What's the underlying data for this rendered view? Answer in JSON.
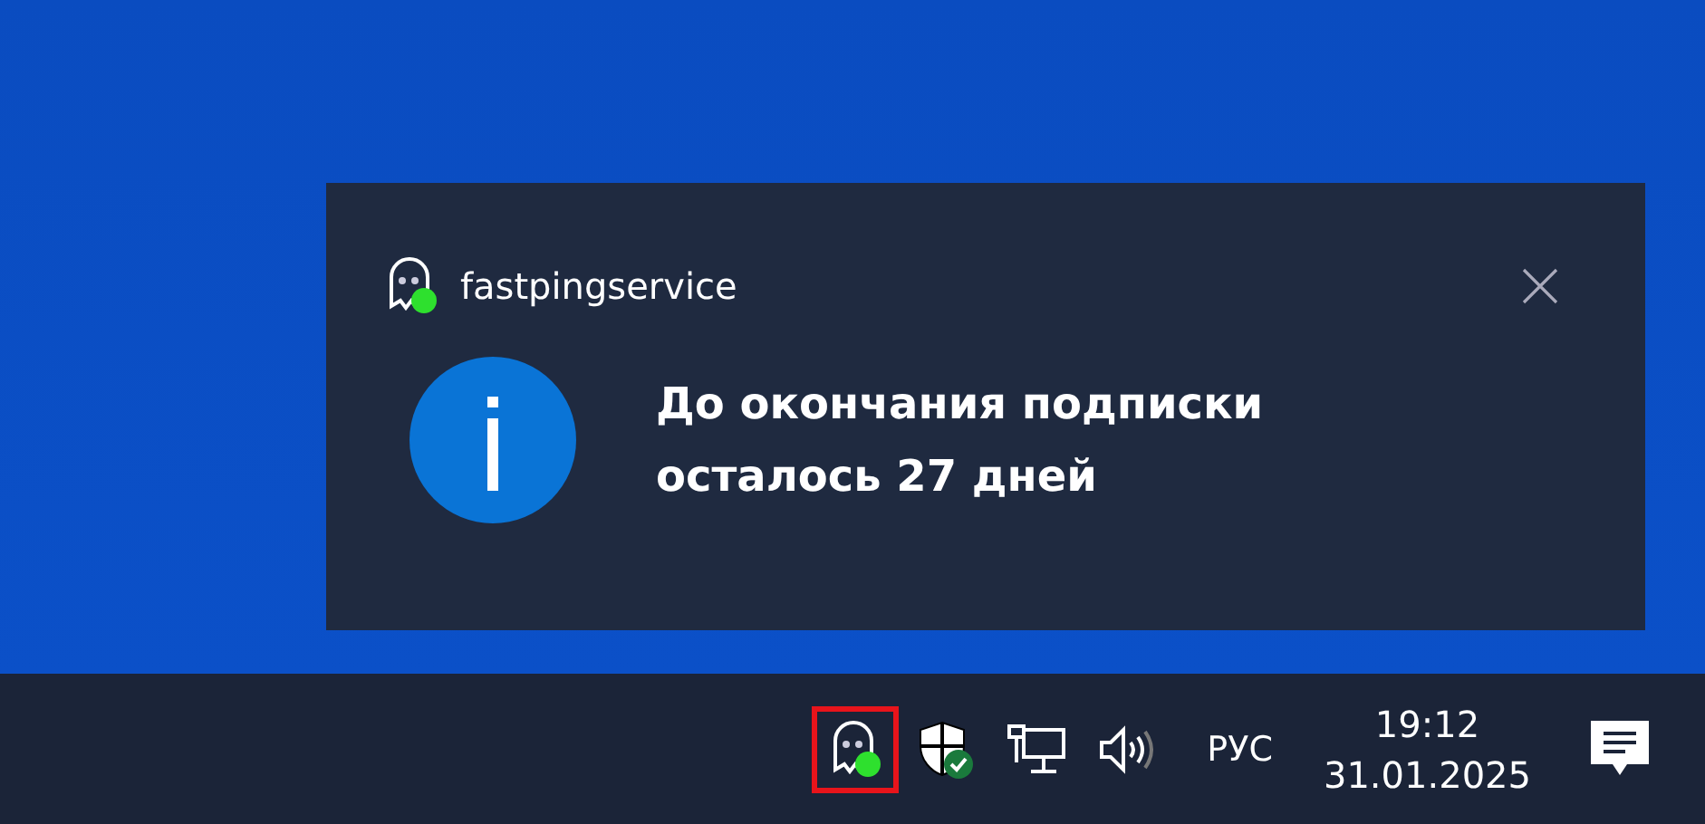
{
  "notification": {
    "app_name": "fastpingservice",
    "message": "До окончания подписки осталось 27 дней"
  },
  "taskbar": {
    "tray_icons": [
      {
        "kind": "ghost",
        "highlighted": true
      },
      {
        "kind": "shield",
        "highlighted": false
      },
      {
        "kind": "network",
        "highlighted": false
      },
      {
        "kind": "volume",
        "highlighted": false
      }
    ],
    "language": "РУС",
    "time": "19:12",
    "date": "31.01.2025"
  }
}
